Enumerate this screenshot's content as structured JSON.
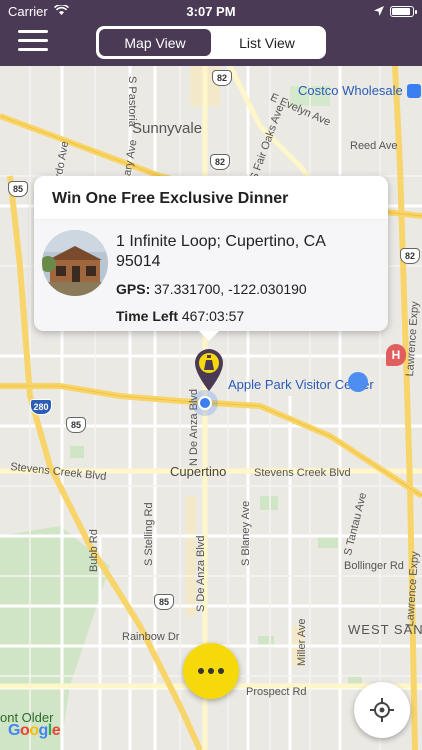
{
  "status_bar": {
    "carrier": "Carrier",
    "time": "3:07 PM",
    "battery_percent": 90
  },
  "header": {
    "segments": [
      {
        "label": "Map View",
        "active": true
      },
      {
        "label": "List View",
        "active": false
      }
    ]
  },
  "callout": {
    "title": "Win One Free Exclusive Dinner",
    "address": "1 Infinite Loop; Cupertino, CA 95014",
    "gps_label": "GPS:",
    "gps_value": "37.331700, -122.030190",
    "time_left_label": "Time Left",
    "time_left_value": "467:03:57"
  },
  "map": {
    "cities": {
      "sunnyvale": "Sunnyvale",
      "cupertino": "Cupertino",
      "west_san": "WEST SAN",
      "font_older": "ont Older"
    },
    "pois": {
      "costco": "Costco Wholesale",
      "apple_park": "Apple Park Visitor Center"
    },
    "streets": {
      "s_pastoria": "S Pastoria",
      "e_evelyn": "E Evelyn Ave",
      "s_bernardo": "S Bernardo Ave",
      "s_mary": "S Mary Ave",
      "s_fair_oaks": "S Fair Oaks Ave",
      "reed": "Reed Ave",
      "lawrence": "Lawrence Expy",
      "lawrence2": "Lawrence Expy",
      "n_de_anza": "N De Anza Blvd",
      "stevens_creek_w": "Stevens Creek Blvd",
      "stevens_creek_e": "Stevens Creek Blvd",
      "s_stelling": "S Stelling Rd",
      "s_blaney": "S Blaney Ave",
      "s_tantau": "S Tantau Ave",
      "bollinger": "Bollinger Rd",
      "bubb": "Bubb Rd",
      "s_de_anza": "S De Anza Blvd",
      "rainbow": "Rainbow Dr",
      "miller": "Miller Ave",
      "prospect": "Prospect Rd"
    },
    "shields": {
      "i280": "280",
      "r85a": "85",
      "r85b": "85",
      "r85c": "85",
      "r82a": "82",
      "r82b": "82",
      "r82c": "82"
    }
  },
  "colors": {
    "header": "#4a3a55",
    "accent_yellow": "#f5d90a",
    "user_blue": "#3a7ef2"
  },
  "icons": {
    "menu": "hamburger-icon",
    "more": "more-dots-icon",
    "locate": "crosshair-icon",
    "wifi": "wifi-icon",
    "location_arrow": "location-arrow-icon"
  },
  "google": "Google"
}
